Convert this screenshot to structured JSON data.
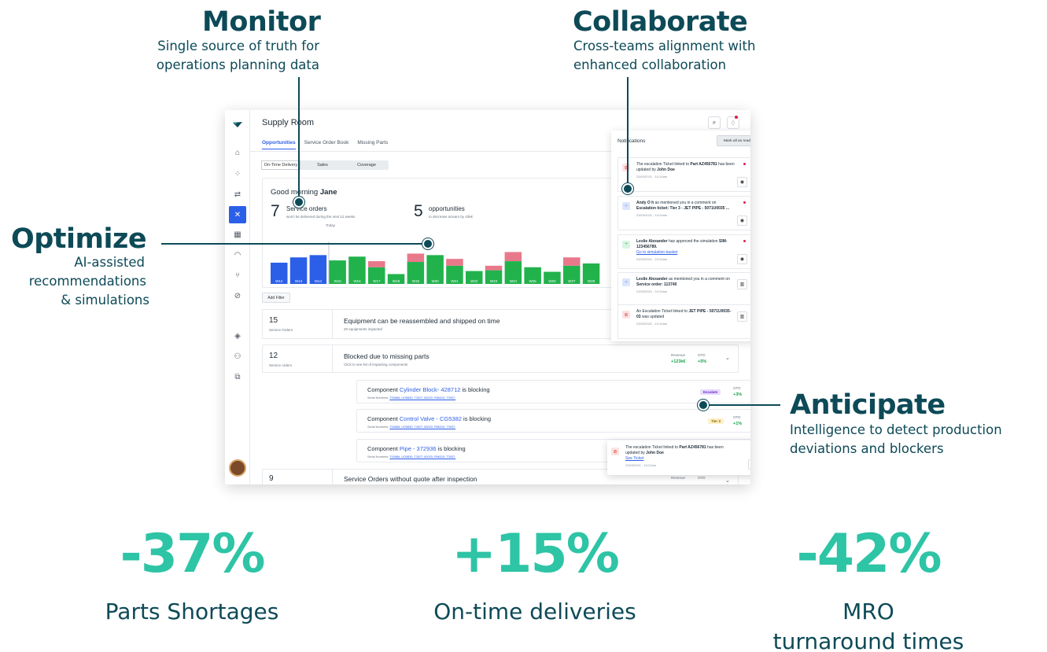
{
  "callouts": {
    "monitor": {
      "title": "Monitor",
      "sub1": "Single source of truth for",
      "sub2": "operations planning data"
    },
    "collaborate": {
      "title": "Collaborate",
      "sub1": "Cross-teams alignment with",
      "sub2": "enhanced collaboration"
    },
    "optimize": {
      "title": "Optimize",
      "sub1": "AI-assisted",
      "sub2": "recommendations",
      "sub3": "& simulations"
    },
    "anticipate": {
      "title": "Anticipate",
      "sub1": "Intelligence to detect production",
      "sub2": "deviations and blockers"
    }
  },
  "kpis": [
    {
      "value": "-37%",
      "label1": "Parts Shortages",
      "label2": ""
    },
    {
      "value": "+15%",
      "label1": "On-time deliveries",
      "label2": ""
    },
    {
      "value": "-42%",
      "label1": "MRO",
      "label2": "turnaround times"
    }
  ],
  "app": {
    "title": "Supply Room",
    "tabs": [
      "Opportunities",
      "Service Order Book",
      "Missing Parts"
    ],
    "segments": [
      "On-Time Delivery",
      "Sales",
      "Coverage"
    ],
    "greeting_prefix": "Good morning",
    "greeting_name": "Jane",
    "stat1": {
      "num": "7",
      "label": "Service orders",
      "sub": "won't be delivered during the next 12 weeks"
    },
    "stat2": {
      "num": "5",
      "label": "opportunities",
      "sub": "to decrease arrears by 42k€"
    },
    "today_label": "Today",
    "add_filter": "Add Filter",
    "rows": [
      {
        "num": "15",
        "sub": "Service Orders",
        "title": "Equipment can be reassembled and shipped on time",
        "desc": "20 equipments impacted"
      },
      {
        "num": "12",
        "sub": "Service orders",
        "title": "Blocked due to missing parts",
        "desc": "Click to see list of impacting components",
        "revenue_head": "Revenue",
        "revenue": "+123k€",
        "otd_head": "OTD",
        "otd": "+5%"
      },
      {
        "num": "9",
        "sub": "",
        "title": "Service Orders without quote after inspection",
        "desc": "",
        "revenue_head": "Revenue",
        "otd_head": "OTD"
      }
    ],
    "components": [
      {
        "prefix": "Component",
        "name": "Cylinder Block- 428712",
        "suffix": "is blocking",
        "serial_label": "Serial Numbers:",
        "serials": "T93686; UO5830; T3027; 83020; R66310; T3937;",
        "badge": "Escalate",
        "otd_head": "OTD",
        "otd": "+3%"
      },
      {
        "prefix": "Component",
        "name": "Control Valve - CG5382",
        "suffix": "is blocking",
        "serial_label": "Serial Numbers:",
        "serials": "T93686; UO5830; T3027; 83020; R66310; T3937;",
        "badge": "Tier 3",
        "otd_head": "OTD",
        "otd": "+1%"
      },
      {
        "prefix": "Component",
        "name": "Pipe - 372936",
        "suffix": "is blocking",
        "serial_label": "Serial Numbers:",
        "serials": "T93686; UO5830; T3027; 83020; R66310; T3937;"
      }
    ],
    "notifications": {
      "title": "Notifications",
      "mark_all": "Mark all as read",
      "items": [
        {
          "t1": "The escalation Ticket linked to",
          "b1": "Part AZ456781",
          "t2": "has been updated by",
          "b2": "John Doe",
          "time": "23/03/2021 - 10:24am"
        },
        {
          "b1": "Andy O h",
          "t1": "as mentioned you in a comment on",
          "b2": "Escalation ticket: Tier 3 - JET PIPE - 5071U0035 ...",
          "time": "23/03/2021 - 10:24am"
        },
        {
          "b1": "Leslie Alexander",
          "t1": "has approved the simulation",
          "b2": "SIM-123456789.",
          "link": "Go to simulation basket",
          "time": "23/03/2021 - 10:24am"
        },
        {
          "b1": "Leslie Alexander",
          "t1": "as mentioned you in a comment on",
          "b2": "Service order: 113740",
          "time": "23/03/2021 - 10:24am"
        },
        {
          "t1": "An Escalation Ticket linked to",
          "b1": "JET PIPE - 5071U0035-03",
          "t2": "was updated",
          "time": "23/03/2021 - 10:24am"
        }
      ]
    },
    "toast": {
      "t1": "The escalation Ticket linked to",
      "b1": "Part AZ456781",
      "t2": "has been updated by",
      "b2": "John Doe",
      "link": "See Ticket",
      "time": "23/03/2021 - 10:24am"
    }
  },
  "chart_data": {
    "type": "bar",
    "categories": [
      "W12",
      "W13",
      "W14",
      "W15",
      "W16",
      "W17",
      "W18",
      "W19",
      "W20",
      "W21",
      "W22",
      "W23",
      "W24",
      "W25",
      "W26",
      "W27",
      "W28"
    ],
    "series": [
      {
        "values": [
          28,
          35,
          38,
          31,
          36,
          22,
          13,
          29,
          38,
          24,
          17,
          18,
          30,
          22,
          16,
          24,
          27
        ]
      },
      {
        "values": [
          0,
          0,
          0,
          0,
          0,
          8,
          0,
          11,
          0,
          9,
          0,
          6,
          12,
          0,
          0,
          11,
          0
        ]
      }
    ],
    "colors": [
      "#2c5fe8",
      "#22b24c",
      "#e8788a"
    ],
    "past_weeks": 3
  }
}
